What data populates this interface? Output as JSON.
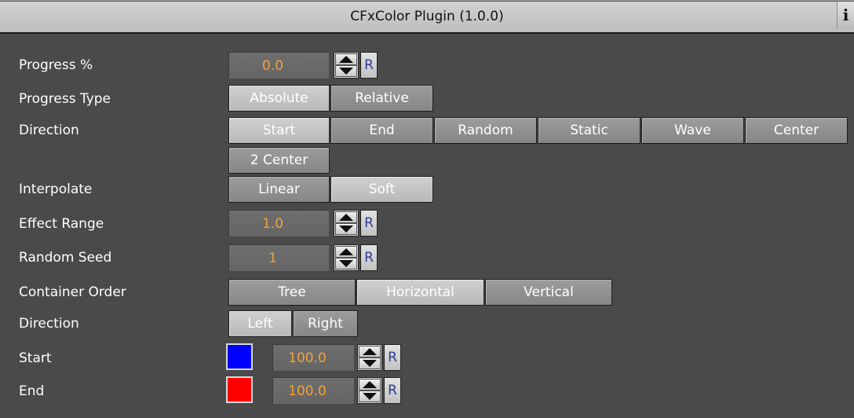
{
  "window": {
    "title": "CFxColor Plugin (1.0.0)",
    "info_icon_glyph": "i"
  },
  "accent_value_color": "#f0a23c",
  "labels": {
    "progress": "Progress %",
    "progress_type": "Progress Type",
    "direction": "Direction",
    "interpolate": "Interpolate",
    "effect_range": "Effect Range",
    "random_seed": "Random Seed",
    "container_order": "Container Order",
    "direction2": "Direction",
    "start": "Start",
    "end": "End"
  },
  "fields": {
    "progress": "0.0",
    "effect_range": "1.0",
    "random_seed": "1",
    "start_alpha": "100.0",
    "end_alpha": "100.0"
  },
  "reset_label": "R",
  "progress_type": {
    "options": [
      "Absolute",
      "Relative"
    ],
    "selected": "Absolute"
  },
  "direction": {
    "options": [
      "Start",
      "End",
      "Random",
      "Static",
      "Wave",
      "Center",
      "2 Center"
    ],
    "selected": "Start"
  },
  "interpolate": {
    "options": [
      "Linear",
      "Soft"
    ],
    "selected": "Soft"
  },
  "container_order": {
    "options": [
      "Tree",
      "Horizontal",
      "Vertical"
    ],
    "selected": "Horizontal"
  },
  "direction2": {
    "options": [
      "Left",
      "Right"
    ],
    "selected": "Left"
  },
  "colors": {
    "start": "#0000ff",
    "end": "#ff0000"
  }
}
